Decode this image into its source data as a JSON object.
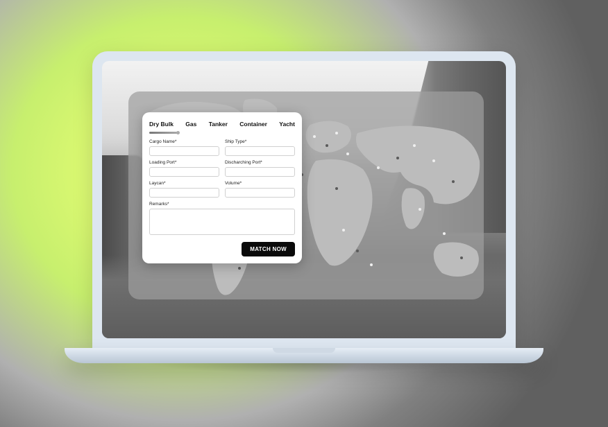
{
  "form": {
    "tabs": [
      {
        "label": "Dry Bulk",
        "active": true
      },
      {
        "label": "Gas",
        "active": false
      },
      {
        "label": "Tanker",
        "active": false
      },
      {
        "label": "Container",
        "active": false
      },
      {
        "label": "Yacht",
        "active": false
      }
    ],
    "fields": {
      "cargo_name": {
        "label": "Cargo Name*",
        "value": ""
      },
      "ship_type": {
        "label": "Ship Type*",
        "value": ""
      },
      "loading_port": {
        "label": "Loading Port*",
        "value": ""
      },
      "discharging_port": {
        "label": "Discharching Port*",
        "value": ""
      },
      "laycan": {
        "label": "Laycan*",
        "value": ""
      },
      "volume": {
        "label": "Volume*",
        "value": ""
      },
      "remarks": {
        "label": "Remarks*",
        "value": ""
      }
    },
    "submit_label": "MATCH NOW"
  },
  "colors": {
    "card_bg": "#ffffff",
    "button_bg": "#0a0a0a",
    "button_fg": "#ffffff",
    "map_panel": "rgba(158,158,158,.72)"
  }
}
